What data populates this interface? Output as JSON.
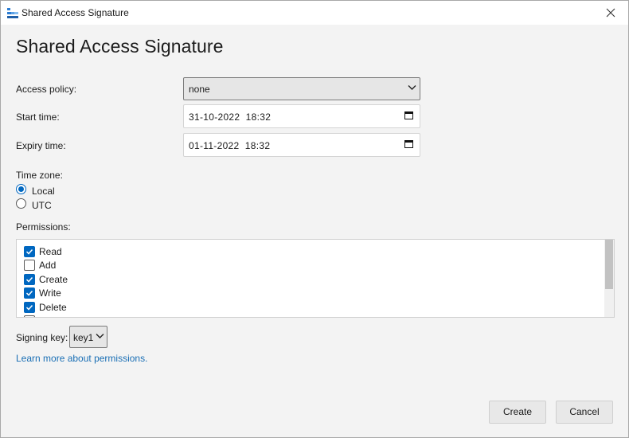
{
  "window": {
    "title": "Shared Access Signature"
  },
  "heading": "Shared Access Signature",
  "form": {
    "access_policy_label": "Access policy:",
    "access_policy_value": "none",
    "start_time_label": "Start time:",
    "start_time_value": "31-10-2022  18:32",
    "expiry_time_label": "Expiry time:",
    "expiry_time_value": "01-11-2022  18:32",
    "time_zone_label": "Time zone:",
    "time_zone_options": [
      {
        "label": "Local",
        "selected": true
      },
      {
        "label": "UTC",
        "selected": false
      }
    ],
    "permissions_label": "Permissions:",
    "permissions": [
      {
        "label": "Read",
        "checked": true
      },
      {
        "label": "Add",
        "checked": false
      },
      {
        "label": "Create",
        "checked": true
      },
      {
        "label": "Write",
        "checked": true
      },
      {
        "label": "Delete",
        "checked": true
      }
    ],
    "signing_key_label": "Signing key:",
    "signing_key_value": "key1",
    "learn_more_link": "Learn more about permissions."
  },
  "buttons": {
    "create": "Create",
    "cancel": "Cancel"
  },
  "colors": {
    "accent": "#0067c0",
    "link": "#1a6fb5"
  },
  "icons": [
    "app-icon",
    "close-icon",
    "chevron-down-icon",
    "calendar-icon",
    "checkmark-icon"
  ]
}
